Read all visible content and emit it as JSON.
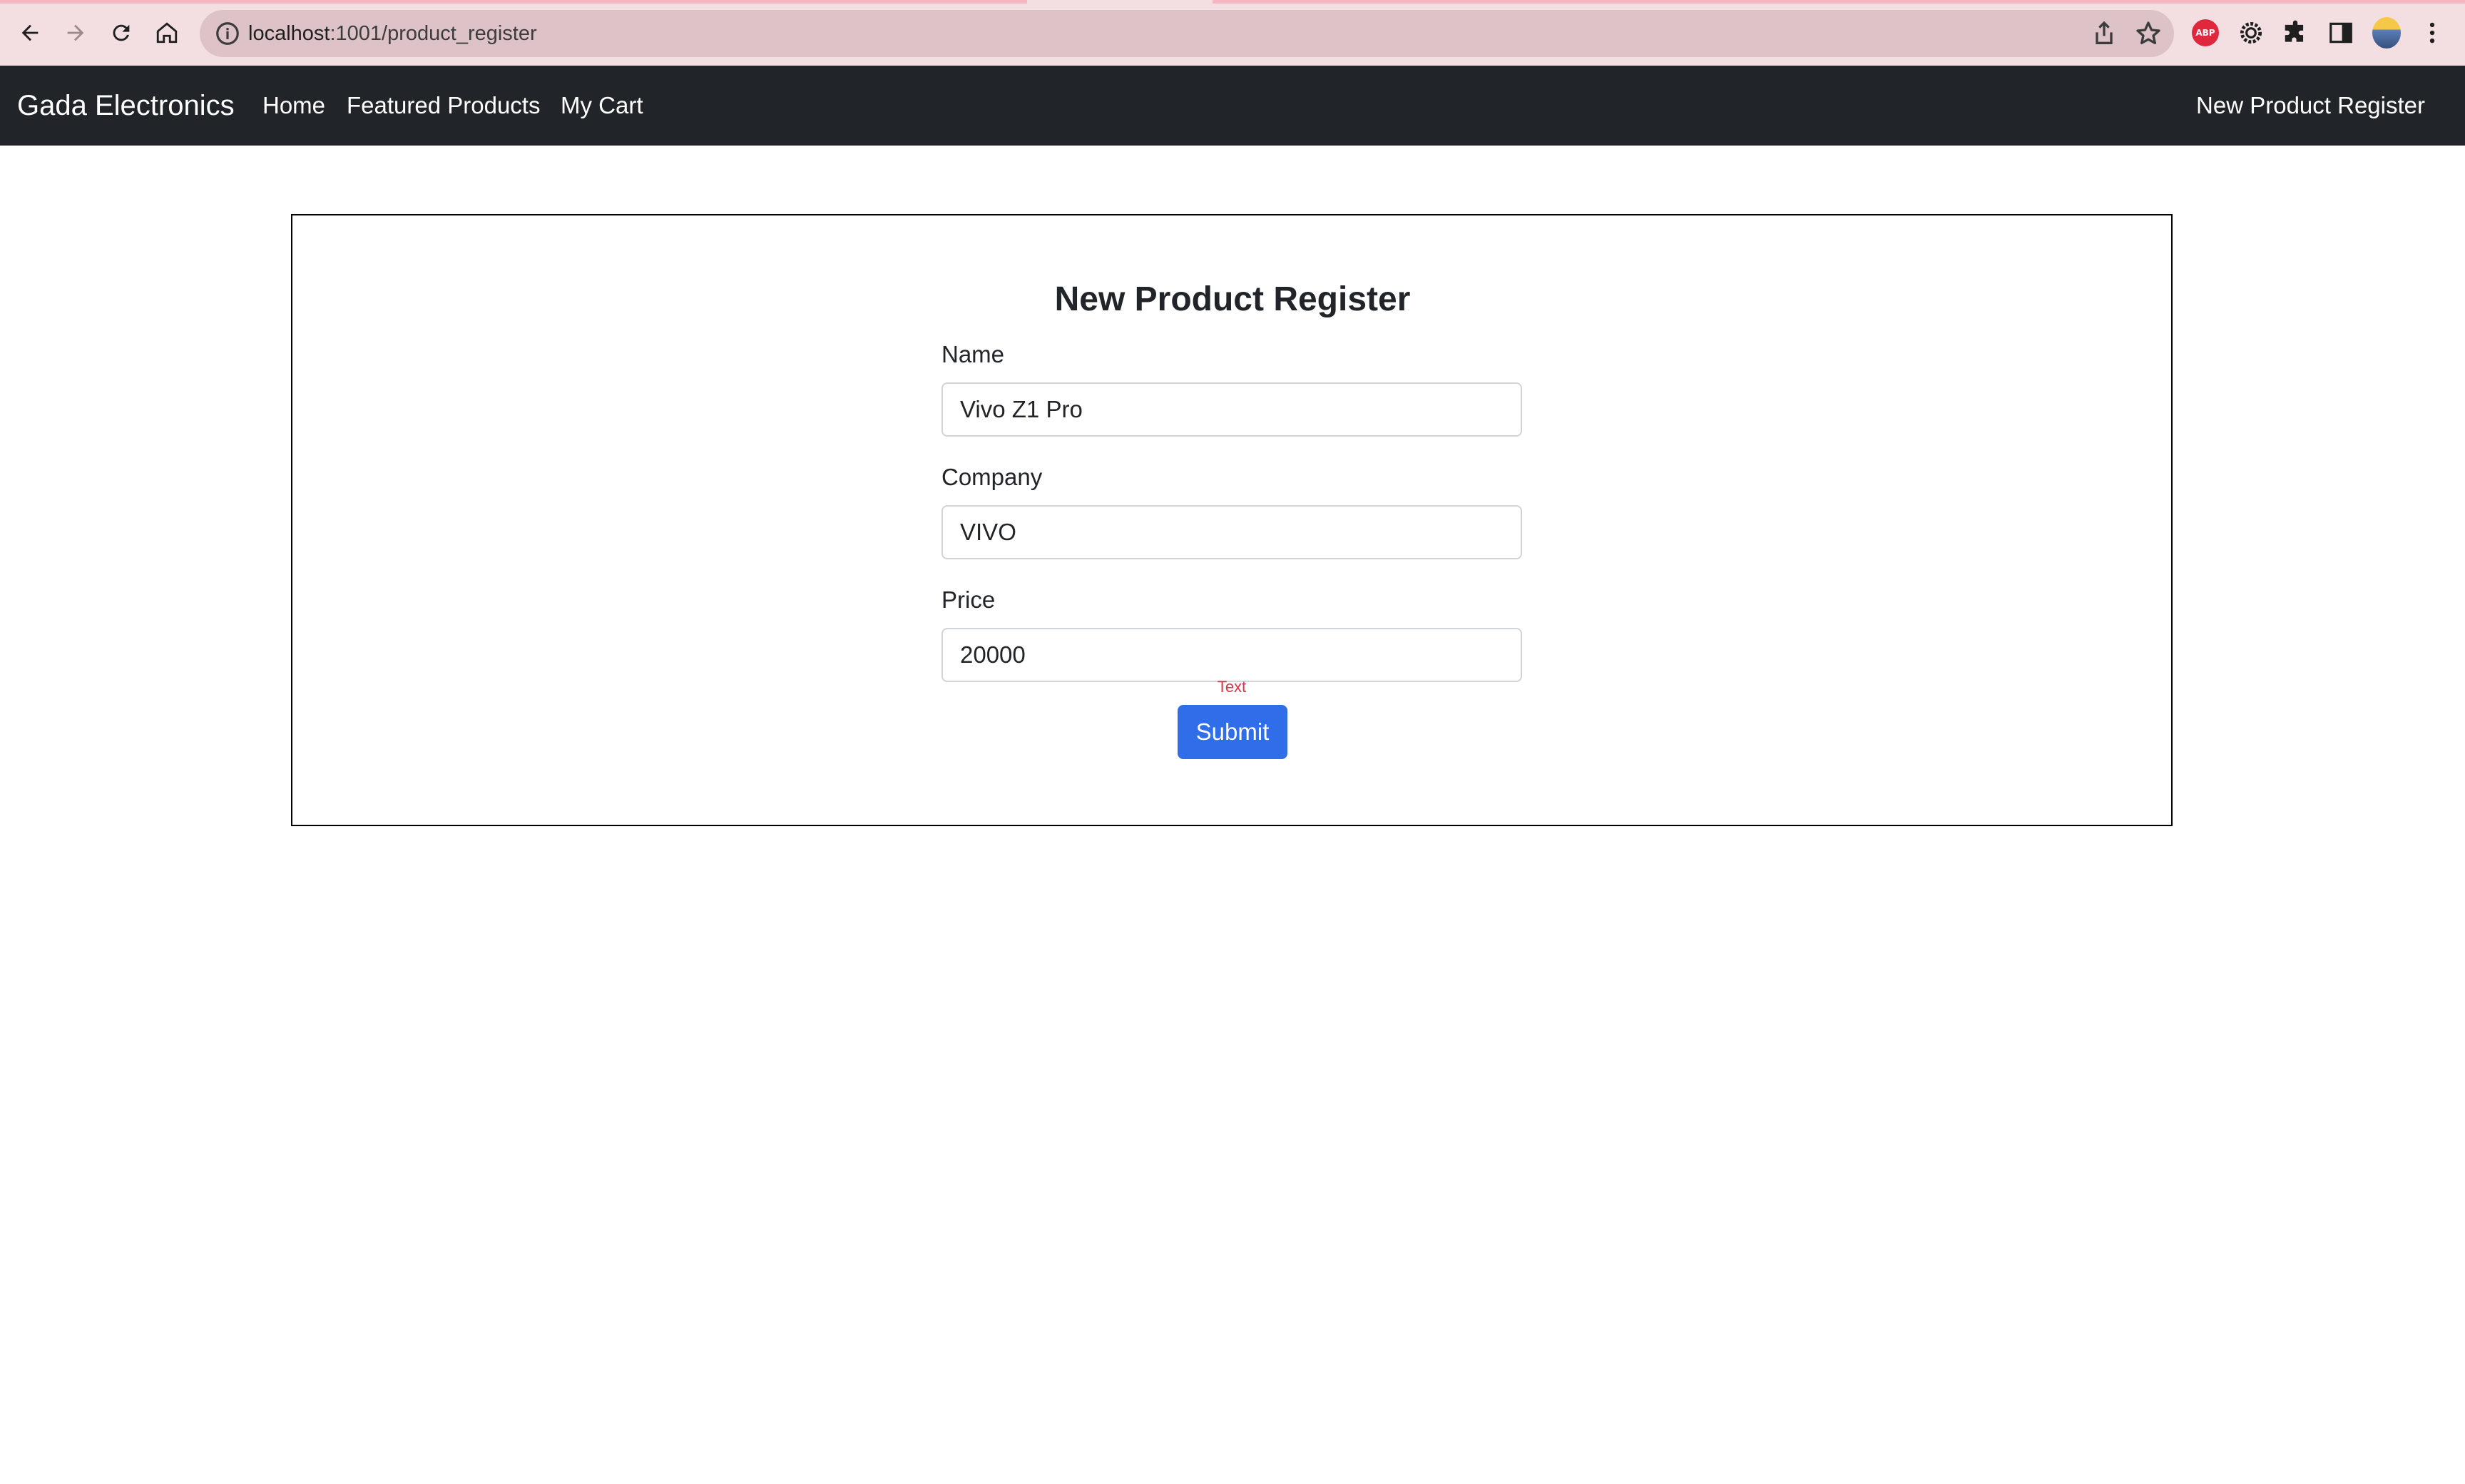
{
  "browser": {
    "url_host": "localhost",
    "url_path": ":1001/product_register",
    "accent_color": "#f3dfe2"
  },
  "navbar": {
    "brand": "Gada Electronics",
    "links": [
      "Home",
      "Featured Products",
      "My Cart"
    ],
    "right_link": "New Product Register",
    "background": "#212529"
  },
  "form": {
    "title": "New Product Register",
    "fields": [
      {
        "label": "Name",
        "value": "Vivo Z1 Pro"
      },
      {
        "label": "Company",
        "value": "VIVO"
      },
      {
        "label": "Price",
        "value": "20000"
      }
    ],
    "hint_text": "Text",
    "submit_label": "Submit",
    "submit_color": "#2f6ee8"
  },
  "icons": [
    "back-arrow-icon",
    "forward-arrow-icon",
    "reload-icon",
    "home-icon",
    "info-icon",
    "share-icon",
    "star-icon",
    "adblock-icon",
    "extension-gear-icon",
    "puzzle-icon",
    "side-panel-icon",
    "avatar",
    "kebab-menu-icon"
  ]
}
